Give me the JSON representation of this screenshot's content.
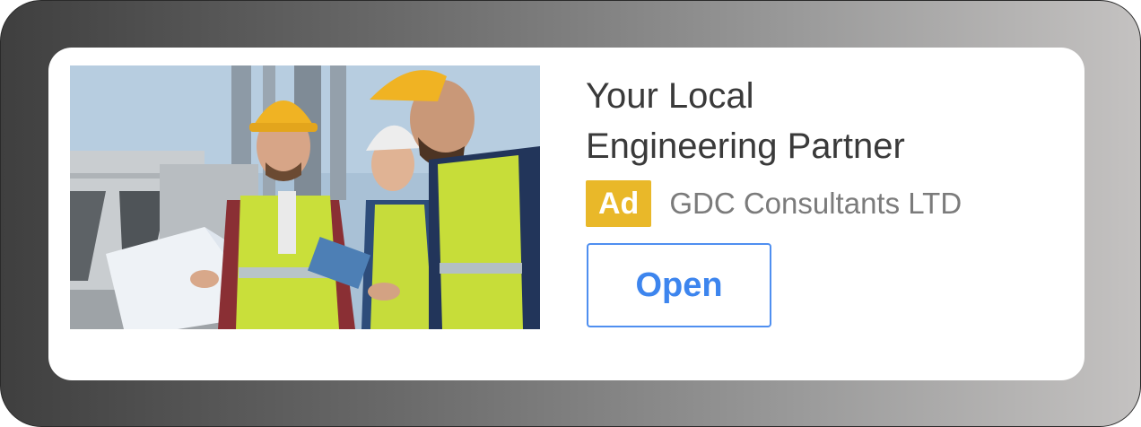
{
  "ad": {
    "headline_line1": "Your Local",
    "headline_line2": "Engineering Partner",
    "badge": "Ad",
    "advertiser": "GDC Consultants LTD",
    "cta_label": "Open",
    "image_alt": "Engineers in hard hats and safety vests reviewing blueprints on a rooftop"
  },
  "colors": {
    "badge_bg": "#e9b829",
    "cta_text": "#3d85ee",
    "cta_border": "#4f8ff0",
    "headline_text": "#3a3a3a",
    "advertiser_text": "#7b7b7b"
  },
  "icons": {
    "photo": "engineers-photo"
  }
}
